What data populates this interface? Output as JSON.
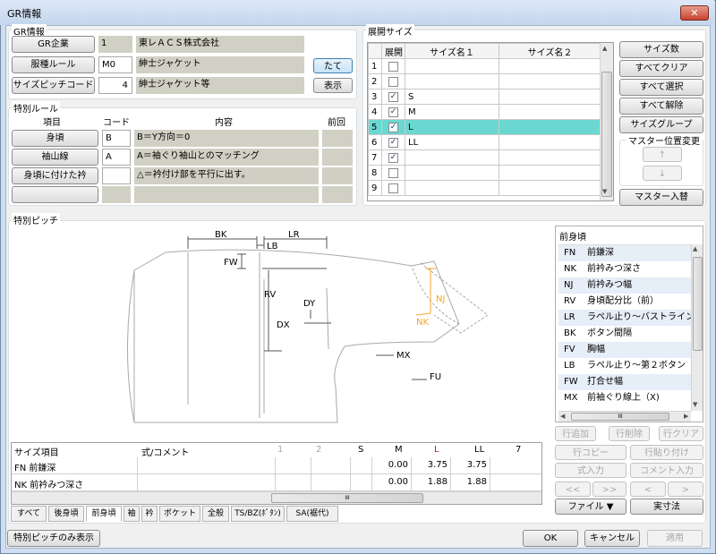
{
  "window": {
    "title": "GR情報",
    "close_glyph": "✕"
  },
  "gr_info": {
    "label": "GR情報",
    "rows": [
      {
        "button": "GR企業",
        "code": "1",
        "name": "東レＡＣＳ株式会社"
      },
      {
        "button": "服種ルール",
        "code": "M0",
        "name": "紳士ジャケット"
      },
      {
        "button": "サイズピッチコード",
        "code": "4",
        "name": "紳士ジャケット等"
      }
    ],
    "orientation_button": "たて",
    "display_button": "表示"
  },
  "special_rules": {
    "label": "特別ルール",
    "headers": [
      "項目",
      "コード",
      "内容",
      "前回"
    ],
    "rows": [
      {
        "item": "身頃",
        "code": "B",
        "content": "B＝Y方向＝0"
      },
      {
        "item": "袖山線",
        "code": "A",
        "content": "A＝袖ぐり袖山とのマッチング"
      },
      {
        "item": "身頃に付けた衿",
        "code": "",
        "content": "△＝衿付け部を平行に出す。"
      },
      {
        "item": "",
        "code": "",
        "content": ""
      }
    ]
  },
  "sizes": {
    "label": "展開サイズ",
    "headers": [
      "展開",
      "サイズ名１",
      "サイズ名２"
    ],
    "rows": [
      {
        "n": "1",
        "checked": false,
        "s1": "",
        "s2": ""
      },
      {
        "n": "2",
        "checked": false,
        "s1": "",
        "s2": ""
      },
      {
        "n": "3",
        "checked": true,
        "s1": "S",
        "s2": ""
      },
      {
        "n": "4",
        "checked": true,
        "s1": "M",
        "s2": ""
      },
      {
        "n": "5",
        "checked": true,
        "s1": "L",
        "s2": "",
        "selected": true
      },
      {
        "n": "6",
        "checked": true,
        "s1": "LL",
        "s2": ""
      },
      {
        "n": "7",
        "checked": true,
        "s1": "",
        "s2": ""
      },
      {
        "n": "8",
        "checked": false,
        "s1": "",
        "s2": ""
      },
      {
        "n": "9",
        "checked": false,
        "s1": "",
        "s2": ""
      }
    ],
    "check_glyph": "✓",
    "scroll_up": "▲",
    "scroll_down": "▼",
    "buttons": [
      "サイズ数",
      "すべてクリア",
      "すべて選択",
      "すべて解除",
      "サイズグループ"
    ],
    "master_label": "マスター位置変更",
    "up_arrow": "↑",
    "down_arrow": "↓",
    "master_swap": "マスター入替"
  },
  "pitch": {
    "label": "特別ピッチ",
    "diagram_labels": {
      "BK": "BK",
      "LR": "LR",
      "LB": "LB",
      "FW": "FW",
      "RV": "RV",
      "DY": "DY",
      "DX": "DX",
      "NJ": "NJ",
      "NK": "NK",
      "MX": "MX",
      "FU": "FU"
    },
    "list_title": "前身頃",
    "list": [
      {
        "code": "FN",
        "name": "前鎌深"
      },
      {
        "code": "NK",
        "name": "前衿みつ深さ"
      },
      {
        "code": "NJ",
        "name": "前衿みつ幅"
      },
      {
        "code": "RV",
        "name": "身頃配分比（前）"
      },
      {
        "code": "LR",
        "name": "ラペル止り～バストライン"
      },
      {
        "code": "BK",
        "name": "ボタン間隔"
      },
      {
        "code": "FV",
        "name": "胸幅"
      },
      {
        "code": "LB",
        "name": "ラペル止り～第２ボタン"
      },
      {
        "code": "FW",
        "name": "打合せ幅"
      },
      {
        "code": "MX",
        "name": "前袖ぐり線上（X)"
      }
    ],
    "list_scroll_up": "▲",
    "list_scroll_down": "▼",
    "left_arrow": "◀",
    "right_arrow": "▶",
    "grip": "III"
  },
  "grid": {
    "headers": [
      "サイズ項目",
      "式/コメント",
      "1",
      "2",
      "S",
      "M",
      "L",
      "LL",
      "7"
    ],
    "rows": [
      {
        "item": "FN 前鎌深",
        "vals": [
          "",
          "",
          "",
          "0.00",
          "3.75",
          "3.75",
          ""
        ]
      },
      {
        "item": "NK 前衿みつ深さ",
        "vals": [
          "",
          "",
          "",
          "0.00",
          "1.88",
          "1.88",
          ""
        ]
      }
    ],
    "grip": "III"
  },
  "tabs": [
    "すべて",
    "後身頃",
    "前身頃",
    "袖",
    "衿",
    "ポケット",
    "全般",
    "TS/BZ(ﾎﾞﾀﾝ)",
    "SA(裾代)"
  ],
  "active_tab": "前身頃",
  "action_buttons": {
    "row_add": "行追加",
    "row_del": "行削除",
    "row_clear": "行クリア",
    "row_copy": "行コピー",
    "row_paste": "行貼り付け",
    "formula": "式入力",
    "comment": "コメント入力",
    "first": "<<",
    "last": ">>",
    "prev": "<",
    "next": ">",
    "file": "ファイル ▼",
    "actual": "実寸法"
  },
  "footer": {
    "only_pitch": "特別ピッチのみ表示",
    "ok": "OK",
    "cancel": "キャンセル",
    "apply": "適用"
  },
  "colors": {
    "accent": "#6ad8d0",
    "orange": "#f5a623",
    "red": "#d01818"
  }
}
